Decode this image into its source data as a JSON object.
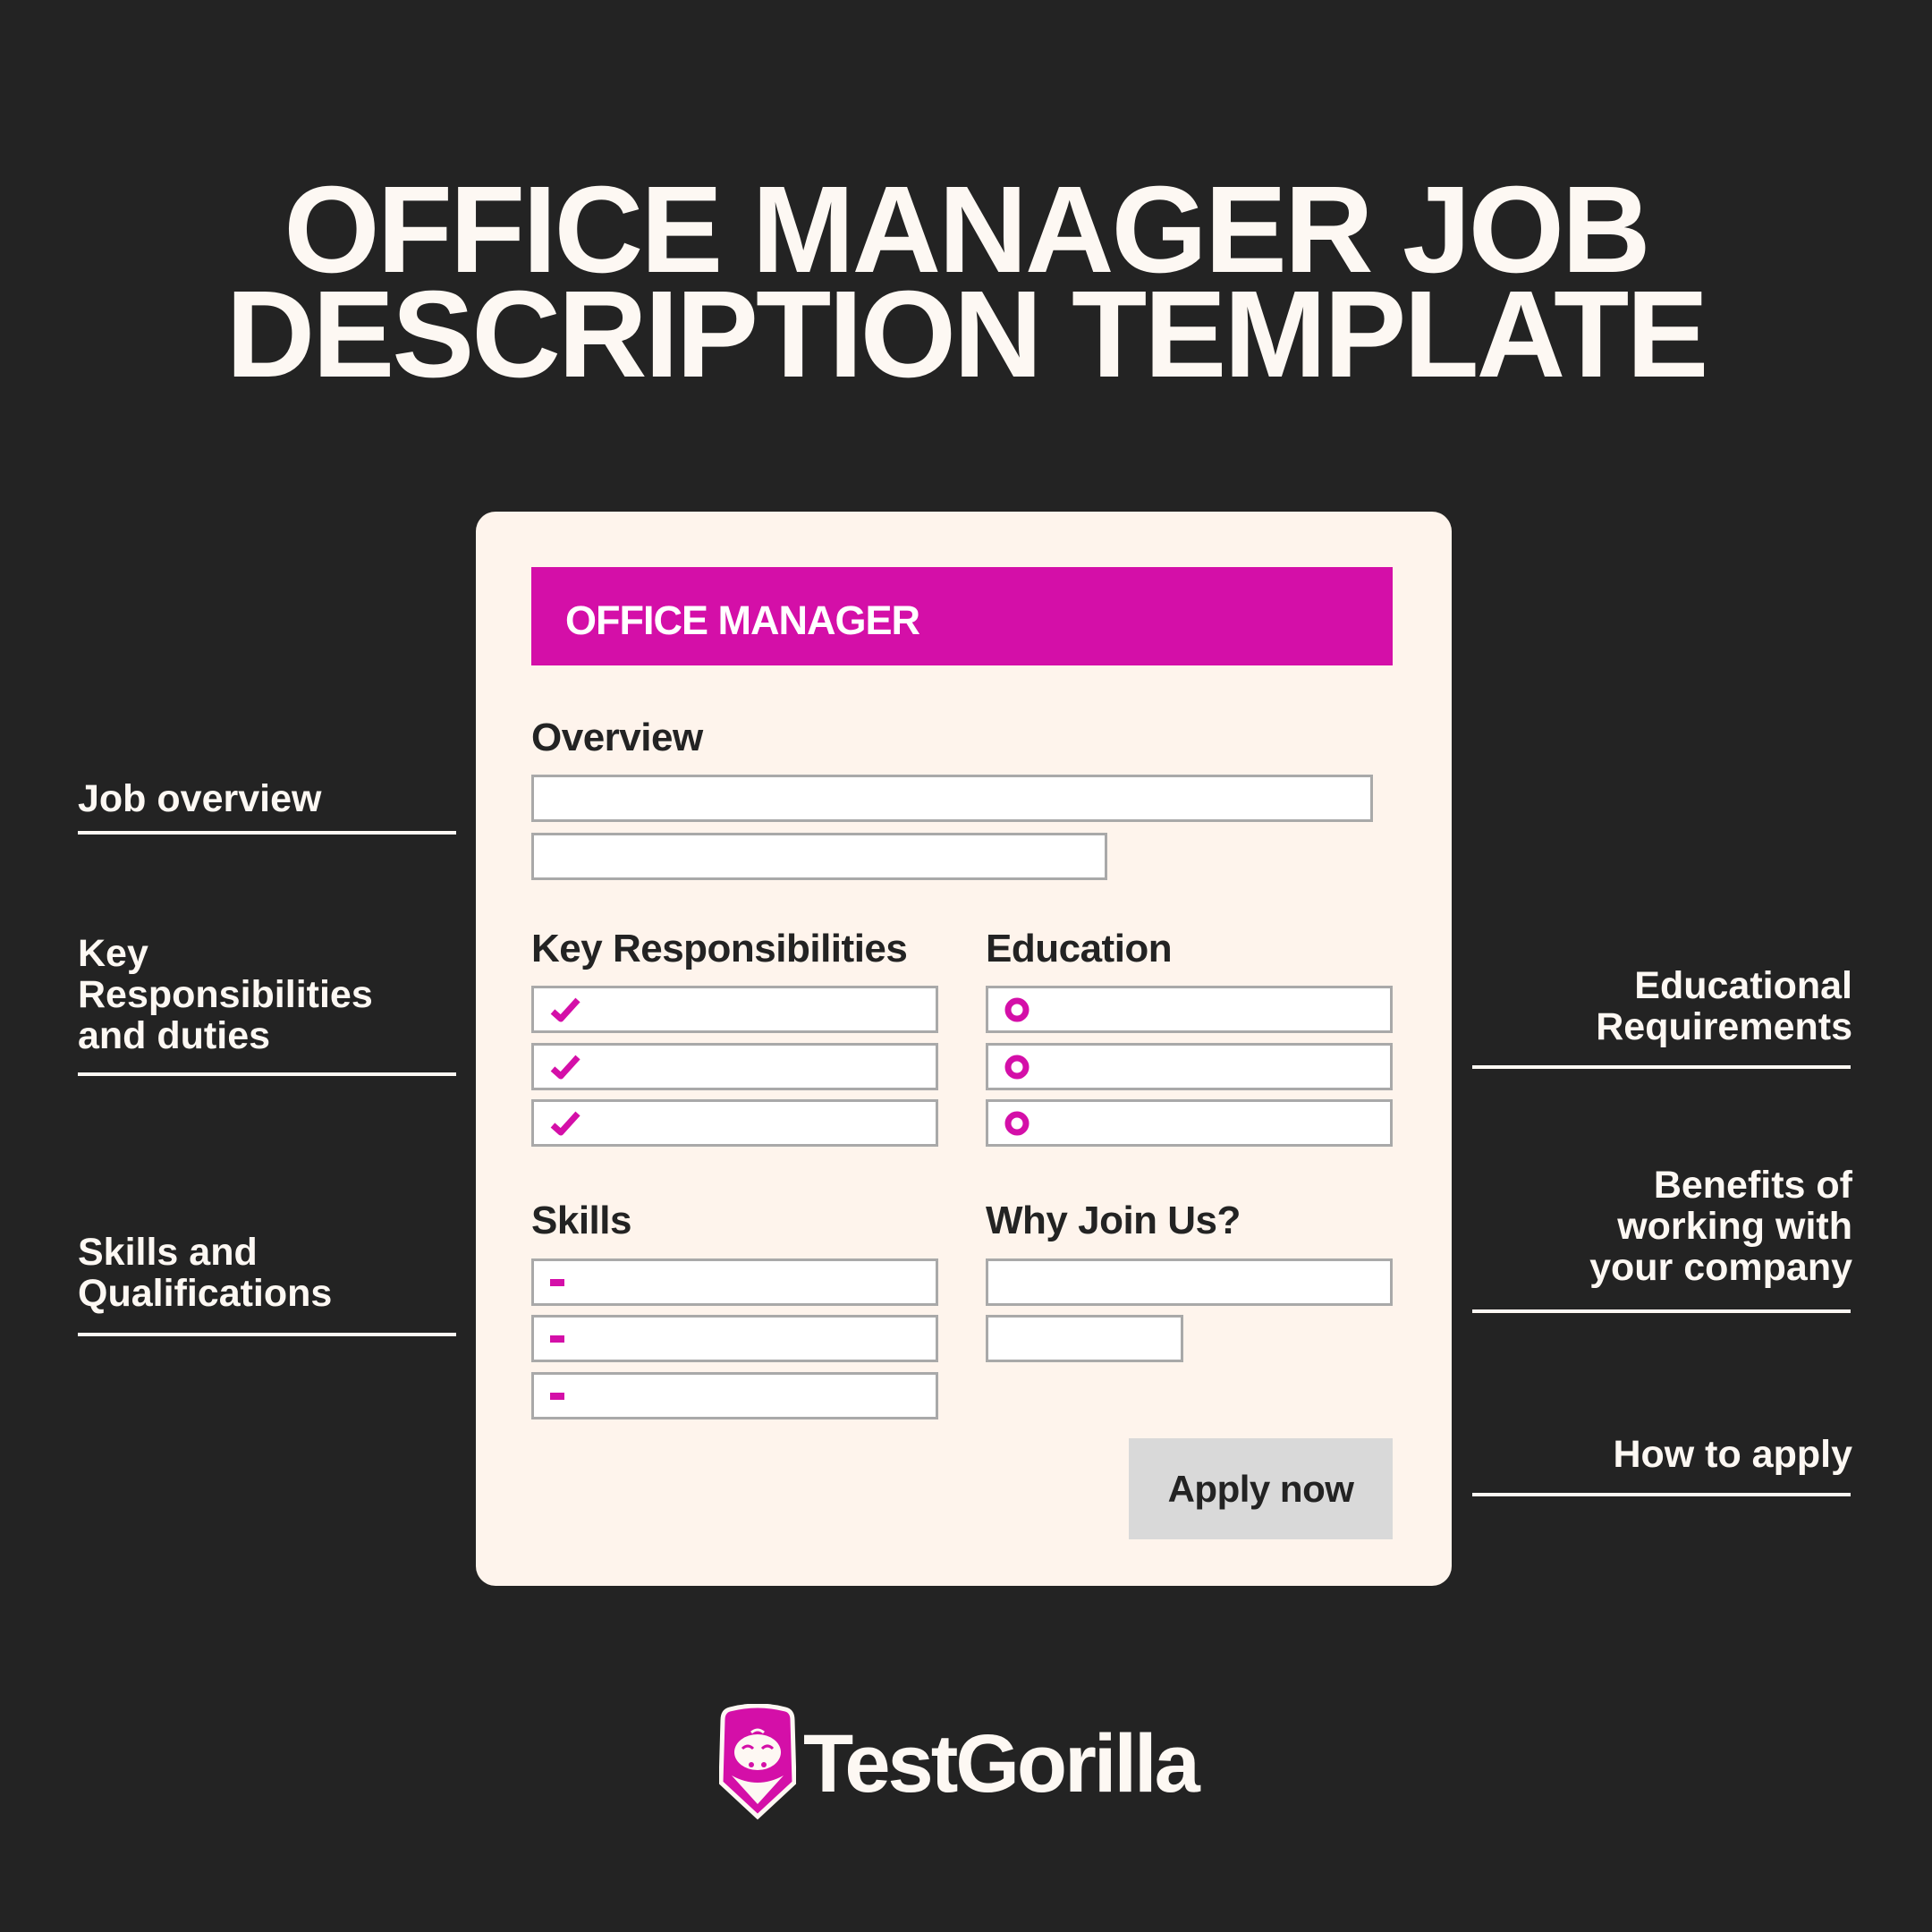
{
  "title": {
    "line1": "OFFICE MANAGER JOB",
    "line2": "DESCRIPTION TEMPLATE"
  },
  "accent_color": "#d40fa8",
  "card": {
    "banner_title": "OFFICE MANAGER",
    "sections": {
      "overview": {
        "heading": "Overview"
      },
      "responsibilities": {
        "heading": "Key Responsibilities",
        "bullet_icon": "checkmark-icon"
      },
      "education": {
        "heading": "Education",
        "bullet_icon": "ring-icon"
      },
      "skills": {
        "heading": "Skills",
        "bullet_icon": "dash-icon"
      },
      "why_join": {
        "heading": "Why Join Us?"
      }
    },
    "apply_button": "Apply now"
  },
  "annotations": {
    "left": [
      {
        "lines": [
          "Job overview"
        ]
      },
      {
        "lines": [
          "Key",
          "Responsibilities",
          "and duties"
        ]
      },
      {
        "lines": [
          "Skills and",
          "Qualifications"
        ]
      }
    ],
    "right": [
      {
        "lines": [
          "Educational",
          "Requirements"
        ]
      },
      {
        "lines": [
          "Benefits of",
          "working with",
          "your company"
        ]
      },
      {
        "lines": [
          "How to apply"
        ]
      }
    ]
  },
  "brand": {
    "name": "TestGorilla",
    "icon": "gorilla-logo-icon"
  }
}
